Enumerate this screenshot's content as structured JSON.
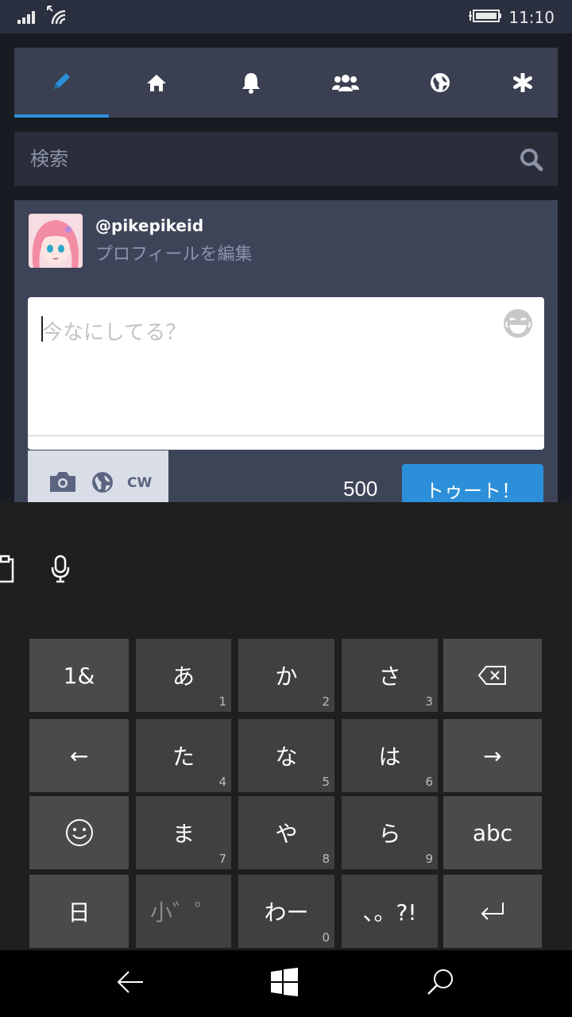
{
  "status_bar": {
    "time": "11:10",
    "icons": [
      "signal-icon",
      "wifi-icon",
      "battery-icon"
    ]
  },
  "nav_tabs": [
    {
      "icon": "pencil-icon",
      "active": true
    },
    {
      "icon": "home-icon",
      "active": false
    },
    {
      "icon": "bell-icon",
      "active": false
    },
    {
      "icon": "users-icon",
      "active": false
    },
    {
      "icon": "globe-icon",
      "active": false
    },
    {
      "icon": "asterisk-icon",
      "active": false
    }
  ],
  "search": {
    "placeholder": "検索"
  },
  "account": {
    "handle": "@pikepikeid",
    "edit_profile": "プロフィールを編集"
  },
  "compose": {
    "placeholder": "今なにしてる？",
    "cw_label": "CW",
    "char_count": "500",
    "submit_label": "トゥート！"
  },
  "keyboard": {
    "rows": [
      [
        {
          "label": "1&",
          "sub": ""
        },
        {
          "label": "あ",
          "sub": "1"
        },
        {
          "label": "か",
          "sub": "2"
        },
        {
          "label": "さ",
          "sub": "3"
        },
        {
          "label": "",
          "sub": "",
          "icon": "backspace-icon"
        }
      ],
      [
        {
          "label": "←",
          "sub": ""
        },
        {
          "label": "た",
          "sub": "4"
        },
        {
          "label": "な",
          "sub": "5"
        },
        {
          "label": "は",
          "sub": "6"
        },
        {
          "label": "→",
          "sub": ""
        }
      ],
      [
        {
          "label": "",
          "sub": "",
          "icon": "smiley-icon"
        },
        {
          "label": "ま",
          "sub": "7"
        },
        {
          "label": "や",
          "sub": "8"
        },
        {
          "label": "ら",
          "sub": "9"
        },
        {
          "label": "abc",
          "sub": ""
        }
      ],
      [
        {
          "label": "日",
          "sub": ""
        },
        {
          "label": "小゛゜",
          "sub": ""
        },
        {
          "label": "わー",
          "sub": "0"
        },
        {
          "label": "、。?!",
          "sub": ""
        },
        {
          "label": "",
          "sub": "",
          "icon": "enter-icon"
        }
      ]
    ]
  },
  "colors": {
    "accent": "#2b90d9",
    "panel": "#3e4458",
    "background": "#191b22"
  }
}
